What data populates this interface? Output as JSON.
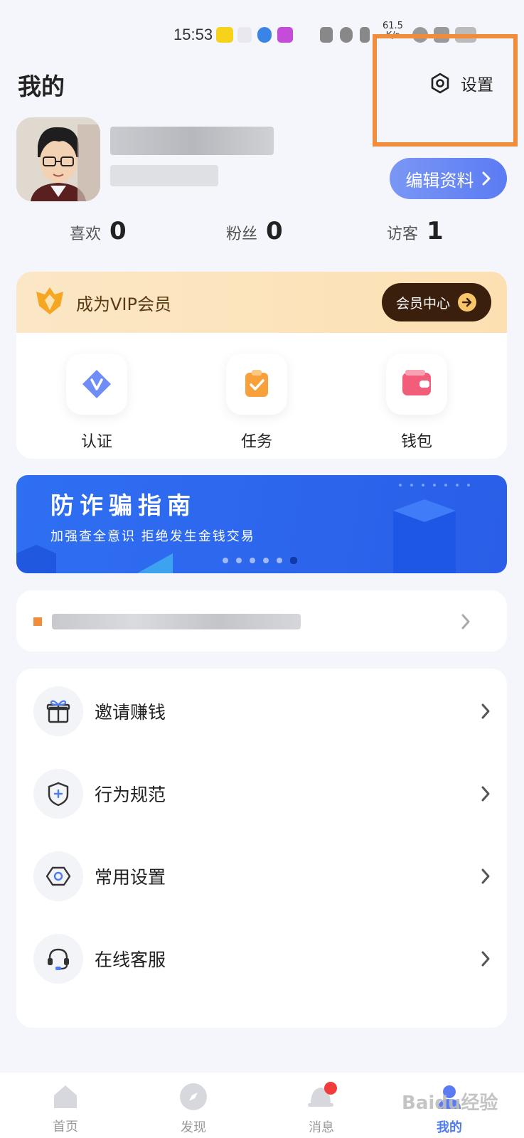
{
  "status_bar": {
    "time": "15:53",
    "net_speed": "61.5",
    "net_unit": "K/s"
  },
  "header": {
    "title": "我的",
    "settings_label": "设置"
  },
  "profile": {
    "edit_label": "编辑资料"
  },
  "stats": [
    {
      "label": "喜欢",
      "value": "0"
    },
    {
      "label": "粉丝",
      "value": "0"
    },
    {
      "label": "访客",
      "value": "1"
    }
  ],
  "vip": {
    "title": "成为VIP会员",
    "center_label": "会员中心",
    "items": [
      {
        "label": "认证",
        "icon": "verify-icon"
      },
      {
        "label": "任务",
        "icon": "task-icon"
      },
      {
        "label": "钱包",
        "icon": "wallet-icon"
      }
    ]
  },
  "banner": {
    "title": "防诈骗指南",
    "subtitle": "加强查全意识 拒绝发生金钱交易",
    "active_dot": 6,
    "dot_count": 6
  },
  "menu": [
    {
      "label": "邀请赚钱",
      "icon": "gift-icon"
    },
    {
      "label": "行为规范",
      "icon": "shield-icon"
    },
    {
      "label": "常用设置",
      "icon": "settings-icon"
    },
    {
      "label": "在线客服",
      "icon": "headset-icon"
    }
  ],
  "bottom_nav": [
    {
      "label": "首页"
    },
    {
      "label": "发现"
    },
    {
      "label": "消息"
    },
    {
      "label": "我的"
    }
  ],
  "watermark": "Baidu经验",
  "colors": {
    "accent": "#5b7bf3",
    "highlight": "#f08c3a",
    "vip_dark": "#3b1f0d"
  }
}
